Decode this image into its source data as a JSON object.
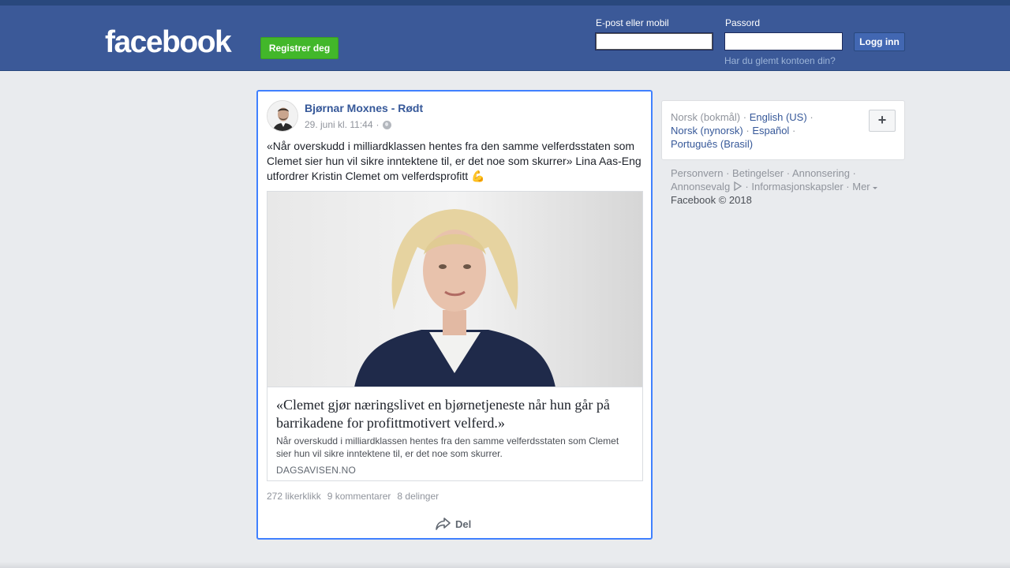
{
  "header": {
    "logo": "facebook",
    "register_label": "Registrer deg",
    "email_label": "E-post eller mobil",
    "email_value": "",
    "password_label": "Passord",
    "password_value": "",
    "login_label": "Logg inn",
    "forgot_label": "Har du glemt kontoen din?"
  },
  "post": {
    "author": "Bjørnar Moxnes - Rødt",
    "timestamp": "29. juni kl. 11:44",
    "separator": "·",
    "privacy_icon": "globe-icon",
    "text": "«Når overskudd i milliardklassen hentes fra den samme velferdsstaten som Clemet sier hun vil sikre inntektene til, er det noe som skurrer» Lina Aas-Eng utfordrer Kristin Clemet om velferdsprofitt 💪",
    "link": {
      "title": "«Clemet gjør næringslivet en bjørnetjeneste når hun går på barrikadene for profittmotivert velferd.»",
      "description": "Når overskudd i milliardklassen hentes fra den samme velferdsstaten som Clemet sier hun vil sikre inntektene til, er det noe som skurrer.",
      "domain": "DAGSAVISEN.NO"
    },
    "likes": "272 likerklikk",
    "comments": "9 kommentarer",
    "shares": "8 delinger",
    "share_label": "Del"
  },
  "languages": {
    "current": "Norsk (bokmål)",
    "sep": "·",
    "items": [
      "English (US)",
      "Norsk (nynorsk)",
      "Español",
      "Português (Brasil)"
    ],
    "add_label": "+"
  },
  "footer": {
    "links": [
      "Personvern",
      "Betingelser",
      "Annonsering",
      "Annonsevalg",
      "Informasjonskapsler",
      "Mer"
    ],
    "copyright": "Facebook © 2018"
  },
  "colors": {
    "brand": "#3b5998",
    "register": "#42b72a",
    "link": "#365899",
    "focus": "#4080ff"
  }
}
